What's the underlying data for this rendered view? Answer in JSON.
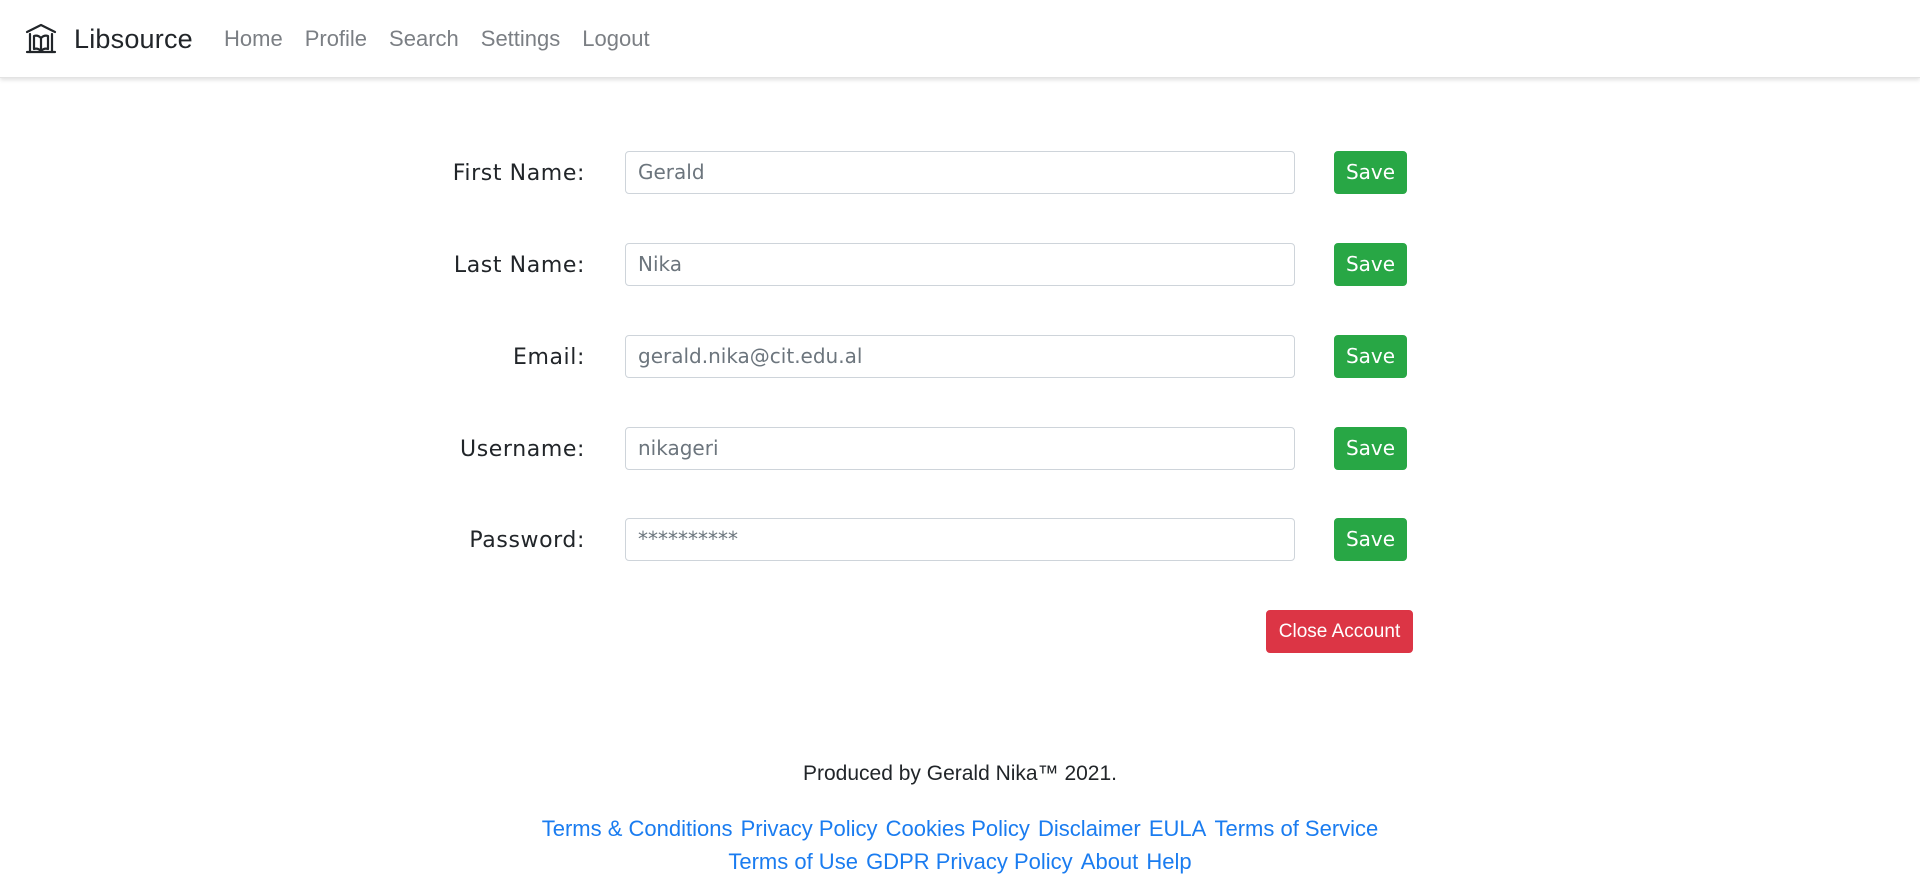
{
  "navbar": {
    "brand": "Libsource",
    "brand_icon": "library-icon",
    "links": [
      "Home",
      "Profile",
      "Search",
      "Settings",
      "Logout"
    ]
  },
  "form": {
    "fields": [
      {
        "label": "First Name:",
        "value": "Gerald",
        "button": "Save"
      },
      {
        "label": "Last Name:",
        "value": "Nika",
        "button": "Save"
      },
      {
        "label": "Email:",
        "value": "gerald.nika@cit.edu.al",
        "button": "Save"
      },
      {
        "label": "Username:",
        "value": "nikageri",
        "button": "Save"
      },
      {
        "label": "Password:",
        "value": "**********",
        "button": "Save"
      }
    ],
    "close_account": "Close Account"
  },
  "footer": {
    "text": "Produced by Gerald Nika™ 2021.",
    "links_row1": [
      "Terms & Conditions",
      "Privacy Policy",
      "Cookies Policy",
      "Disclaimer",
      "EULA",
      "Terms of Service"
    ],
    "links_row2": [
      "Terms of Use",
      "GDPR Privacy Policy",
      "About",
      "Help"
    ]
  },
  "colors": {
    "save": "#28a745",
    "danger": "#dc3545",
    "link": "#1a7cf0",
    "nav_text": "#7b7f84"
  }
}
